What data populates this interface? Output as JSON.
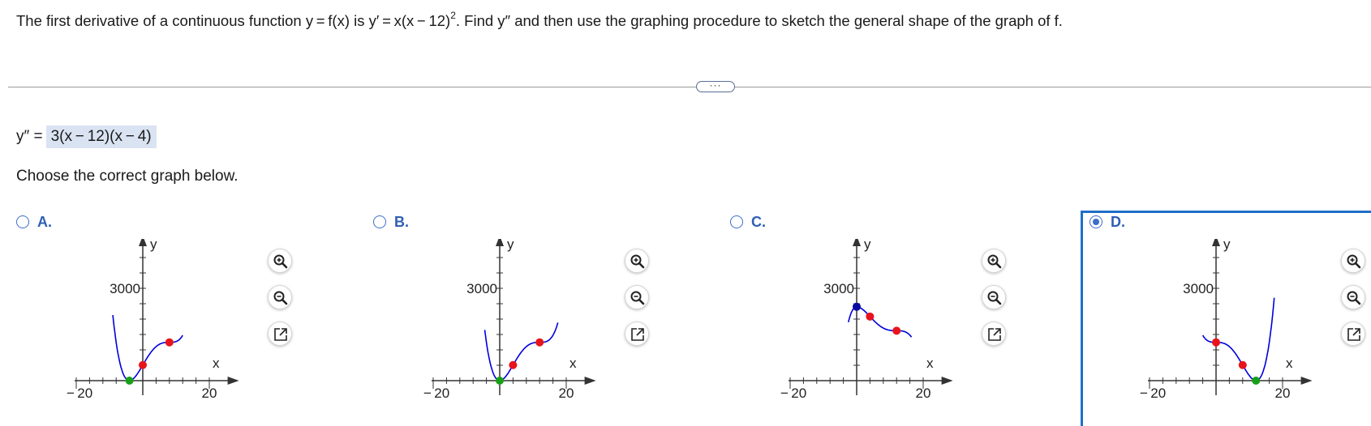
{
  "question": {
    "part1": "The first derivative of a continuous function y = f(x) is y′ = x(x − 12)",
    "exponent": "2",
    "part2": ". Find y″ and then use the graphing procedure to sketch the general shape of the graph of f."
  },
  "expand_button": "···",
  "answer": {
    "label": "y″ =",
    "value": "3(x − 12)(x − 4)"
  },
  "prompt": "Choose the correct graph below.",
  "graph_labels": {
    "y_axis": "y",
    "x_axis": "x",
    "y_tick": "3000",
    "x_min": "− 20",
    "x_max": "20"
  },
  "options": [
    {
      "letter": "A.",
      "selected": false,
      "variant": "A"
    },
    {
      "letter": "B.",
      "selected": false,
      "variant": "B"
    },
    {
      "letter": "C.",
      "selected": false,
      "variant": "C"
    },
    {
      "letter": "D.",
      "selected": true,
      "variant": "D"
    }
  ],
  "tools": {
    "zoom_in": "zoom-in-icon",
    "zoom_out": "zoom-out-icon",
    "popout": "popout-icon"
  },
  "colors": {
    "curve": "#0000dd",
    "inflection_point": "#e8141c",
    "min_point": "#17a017",
    "max_point": "#0a0aa0",
    "selection": "#1e6fc6",
    "answer_bg": "#d9e3f2"
  }
}
